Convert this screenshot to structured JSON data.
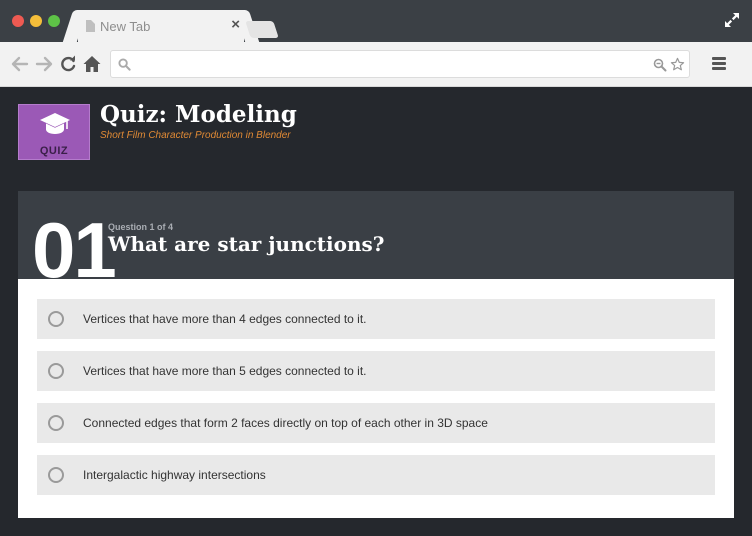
{
  "browser": {
    "tab_title": "New Tab",
    "tab_close": "×",
    "address_value": "",
    "address_placeholder": ""
  },
  "quiz": {
    "badge_label": "QUIZ",
    "title": "Quiz: Modeling",
    "subtitle": "Short Film Character Production in Blender",
    "accent_color": "#9b59b6",
    "subtitle_color": "#e08a35"
  },
  "question": {
    "number": "01",
    "counter": "Question 1 of 4",
    "text": "What are star junctions?"
  },
  "answers": [
    {
      "label": "Vertices that have more than 4 edges connected to it."
    },
    {
      "label": "Vertices that have more than 5 edges connected to it."
    },
    {
      "label": "Connected edges that form 2 faces directly on top of each other in 3D space"
    },
    {
      "label": "Intergalactic highway intersections"
    }
  ],
  "icons": {
    "tab": "page-icon",
    "back": "arrow-left-icon",
    "forward": "arrow-right-icon",
    "reload": "reload-icon",
    "home": "home-icon",
    "search": "search-icon",
    "zoom": "zoom-icon",
    "star": "star-icon",
    "menu": "hamburger-menu-icon",
    "fullscreen": "fullscreen-icon",
    "badge": "graduation-cap-icon"
  }
}
